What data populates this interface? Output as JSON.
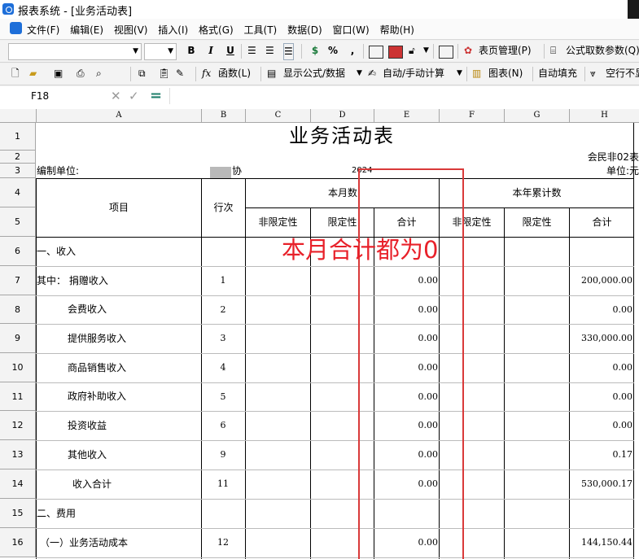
{
  "window": {
    "title": "报表系统 - [业务活动表]"
  },
  "menu": [
    "文件(F)",
    "编辑(E)",
    "视图(V)",
    "插入(I)",
    "格式(G)",
    "工具(T)",
    "数据(D)",
    "窗口(W)",
    "帮助(H)"
  ],
  "toolbar": {
    "bold": "B",
    "italic": "I",
    "underline": "U",
    "currency": "$",
    "percent": "%",
    "comma": ",",
    "page_manage": "表页管理(P)",
    "formula_params": "公式取数参数(Q)",
    "function": "函数(L)",
    "show_formula": "显示公式/数据",
    "auto_manual": "自动/手动计算",
    "chart": "图表(N)",
    "auto_fill": "自动填充",
    "skip_empty": "空行不显示"
  },
  "formula_bar": {
    "cell_ref": "F18",
    "value": ""
  },
  "columns": [
    "A",
    "B",
    "C",
    "D",
    "E",
    "F",
    "G",
    "H"
  ],
  "row_numbers": [
    "1",
    "2",
    "3",
    "4",
    "5",
    "6",
    "7",
    "8",
    "9",
    "10",
    "11",
    "12",
    "13",
    "14",
    "15",
    "16"
  ],
  "report": {
    "title": "业务活动表",
    "form_code": "会民非02表",
    "org_label": "编制单位:",
    "org_suffix": "协",
    "year": "2024",
    "unit": "单位:元",
    "header_item": "项目",
    "header_line": "行次",
    "header_month": "本月数",
    "header_year": "本年累计数",
    "sub_unrestricted": "非限定性",
    "sub_restricted": "限定性",
    "sub_total": "合计"
  },
  "rows": [
    {
      "item": "一、收入",
      "line": "",
      "month_total": "",
      "year_total": ""
    },
    {
      "item": "其中： 捐赠收入",
      "line": "1",
      "month_total": "0.00",
      "year_total": "200,000.00"
    },
    {
      "item": "会费收入",
      "line": "2",
      "month_total": "0.00",
      "year_total": "0.00"
    },
    {
      "item": "提供服务收入",
      "line": "3",
      "month_total": "0.00",
      "year_total": "330,000.00"
    },
    {
      "item": "商品销售收入",
      "line": "4",
      "month_total": "0.00",
      "year_total": "0.00"
    },
    {
      "item": "政府补助收入",
      "line": "5",
      "month_total": "0.00",
      "year_total": "0.00"
    },
    {
      "item": "投资收益",
      "line": "6",
      "month_total": "0.00",
      "year_total": "0.00"
    },
    {
      "item": "其他收入",
      "line": "9",
      "month_total": "0.00",
      "year_total": "0.17"
    },
    {
      "item": "收入合计",
      "line": "11",
      "month_total": "0.00",
      "year_total": "530,000.17"
    },
    {
      "item": "二、费用",
      "line": "",
      "month_total": "",
      "year_total": ""
    },
    {
      "item": "（一）业务活动成本",
      "line": "12",
      "month_total": "0.00",
      "year_total": "144,150.44"
    }
  ],
  "annotation": {
    "text": "本月合计都为0",
    "color": "#e8212a"
  }
}
